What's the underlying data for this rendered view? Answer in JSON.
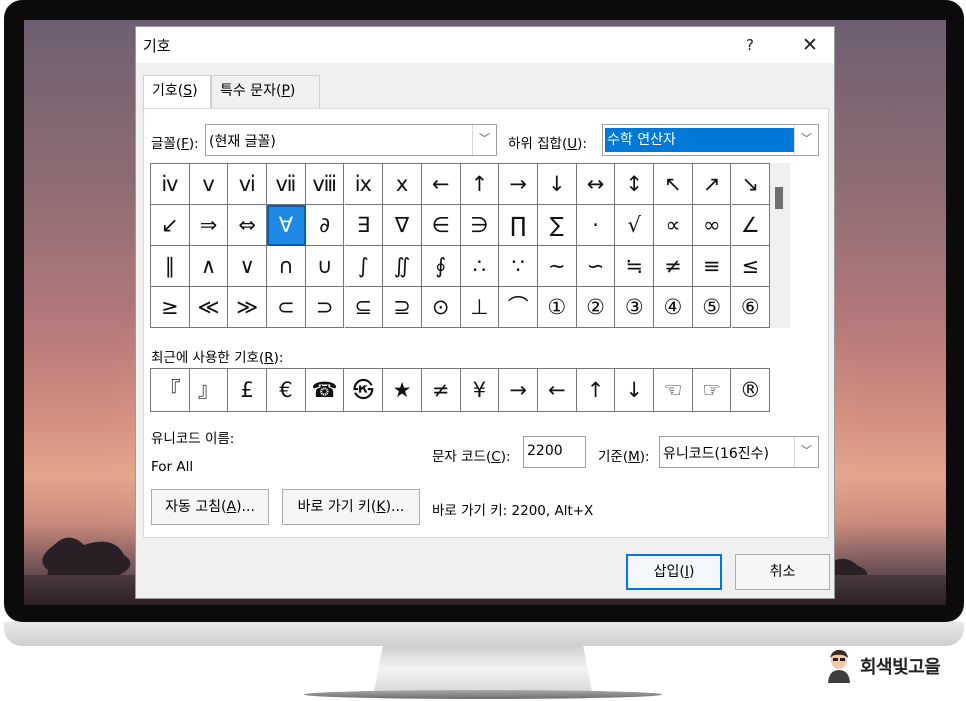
{
  "dialog": {
    "title": "기호",
    "help_glyph": "?",
    "close_glyph": "✕"
  },
  "tabs": [
    {
      "label_pre": "기호(",
      "accel": "S",
      "label_post": ")"
    },
    {
      "label_pre": "특수 문자(",
      "accel": "P",
      "label_post": ")"
    }
  ],
  "font": {
    "label_pre": "글꼴(",
    "accel": "F",
    "label_post": "):",
    "value": "(현재 글꼴)"
  },
  "subset": {
    "label_pre": "하위 집합(",
    "accel": "U",
    "label_post": "):",
    "value": "수학 연산자"
  },
  "symbols": [
    [
      "ⅳ",
      "ⅴ",
      "ⅵ",
      "ⅶ",
      "ⅷ",
      "ⅸ",
      "ⅹ",
      "←",
      "↑",
      "→",
      "↓",
      "↔",
      "↕",
      "↖",
      "↗",
      "↘"
    ],
    [
      "↙",
      "⇒",
      "⇔",
      "∀",
      "∂",
      "∃",
      "∇",
      "∈",
      "∋",
      "∏",
      "∑",
      "·",
      "√",
      "∝",
      "∞",
      "∠"
    ],
    [
      "∥",
      "∧",
      "∨",
      "∩",
      "∪",
      "∫",
      "∬",
      "∮",
      "∴",
      "∵",
      "∼",
      "∽",
      "≒",
      "≠",
      "≡",
      "≤"
    ],
    [
      "≥",
      "≪",
      "≫",
      "⊂",
      "⊃",
      "⊆",
      "⊇",
      "⊙",
      "⊥",
      "⌒",
      "①",
      "②",
      "③",
      "④",
      "⑤",
      "⑥"
    ]
  ],
  "selected_symbol": {
    "row": 1,
    "col": 3
  },
  "recent": {
    "label_pre": "최근에 사용한 기호(",
    "accel": "R",
    "label_post": "):",
    "items": [
      "『",
      "』",
      "£",
      "€",
      "☎",
      "㉿",
      "★",
      "≠",
      "¥",
      "→",
      "←",
      "↑",
      "↓",
      "☜",
      "☞",
      "®"
    ]
  },
  "unicode_name": {
    "label": "유니코드 이름:",
    "value": "For All"
  },
  "char_code": {
    "label_pre": "문자 코드(",
    "accel": "C",
    "label_post": "):",
    "value": "2200"
  },
  "from": {
    "label_pre": "기준(",
    "accel": "M",
    "label_post": "):",
    "value": "유니코드(16진수)"
  },
  "buttons": {
    "autocorrect": {
      "label_pre": "자동 고침(",
      "accel": "A",
      "label_post": ")..."
    },
    "shortcut": {
      "label_pre": "바로 가기 키(",
      "accel": "K",
      "label_post": ")..."
    },
    "insert": {
      "label_pre": "삽입(",
      "accel": "I",
      "label_post": ")"
    },
    "cancel": {
      "label": "취소"
    }
  },
  "shortcut_info": "바로 가기 키: 2200, Alt+X",
  "brand": {
    "name": "회색빛고을"
  },
  "colors": {
    "selection": "#0078d7",
    "dialog_bg": "#f0f0f0"
  }
}
